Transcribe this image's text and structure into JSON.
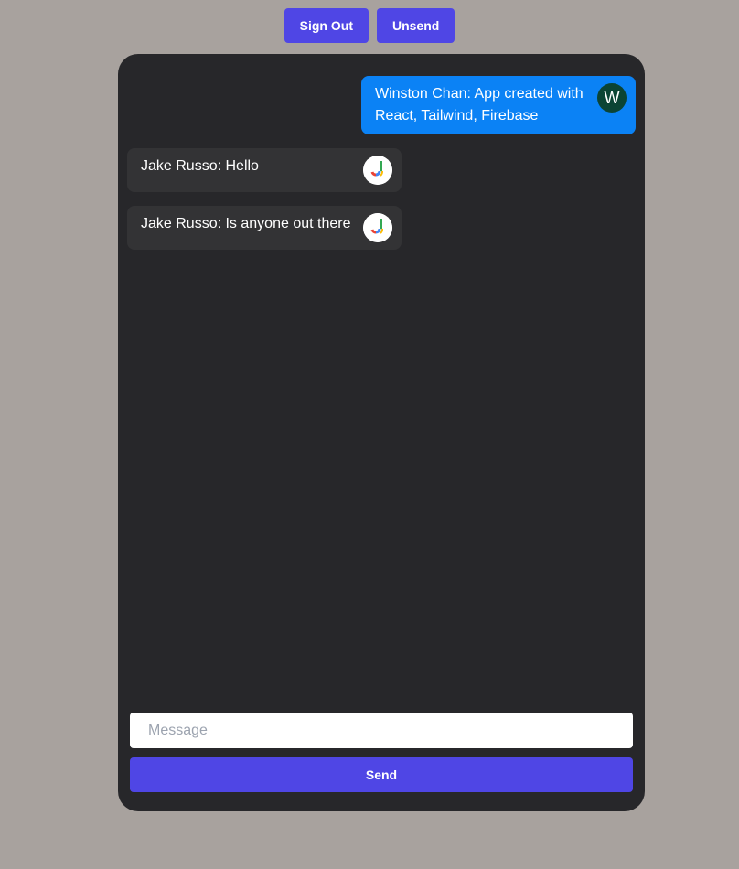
{
  "header": {
    "sign_out_label": "Sign Out",
    "unsend_label": "Unsend"
  },
  "messages": [
    {
      "sender": "Winston Chan",
      "text": "Winston Chan: App created with React, Tailwind, Firebase",
      "avatar_letter": "W",
      "direction": "outgoing"
    },
    {
      "sender": "Jake Russo",
      "text": "Jake Russo: Hello",
      "avatar_icon": "google-avatar-icon",
      "direction": "incoming"
    },
    {
      "sender": "Jake Russo",
      "text": "Jake Russo: Is anyone out there",
      "avatar_icon": "google-avatar-icon",
      "direction": "incoming"
    }
  ],
  "composer": {
    "placeholder": "Message",
    "value": "",
    "send_label": "Send"
  },
  "colors": {
    "page_background": "#a8a29e",
    "panel_background": "#27272a",
    "accent": "#4f46e5",
    "outgoing_bubble": "#0b82f5",
    "incoming_bubble": "#333335"
  }
}
